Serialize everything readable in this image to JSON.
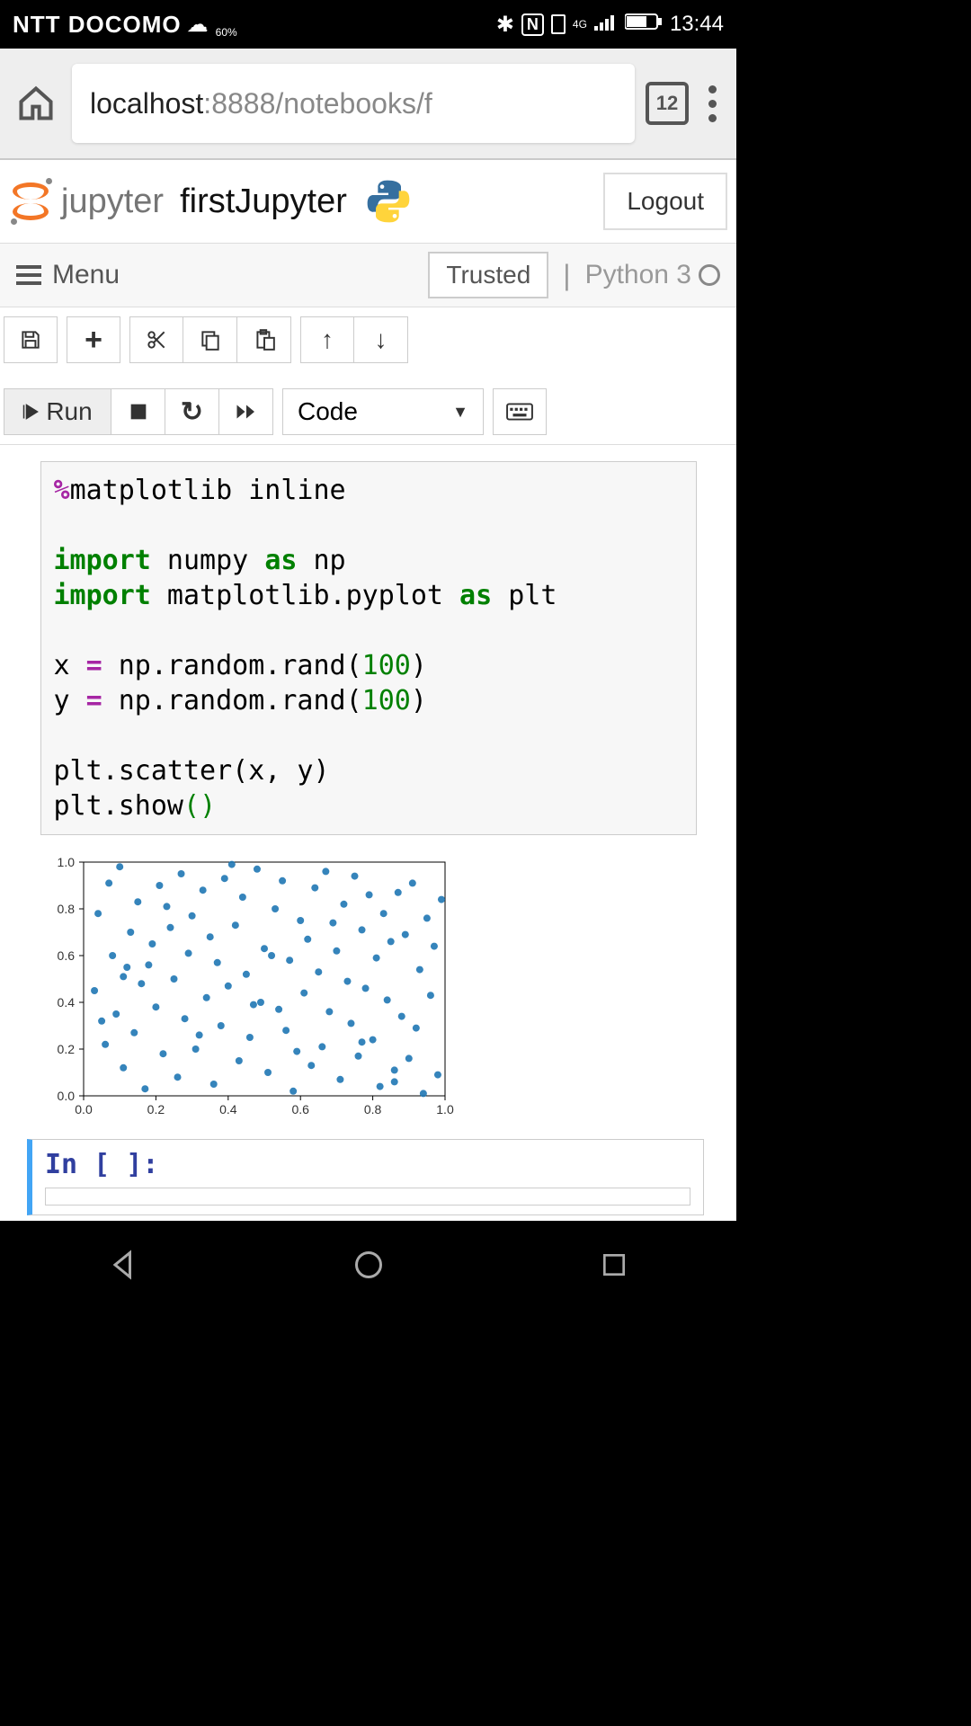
{
  "status": {
    "carrier": "NTT DOCOMO",
    "weather_sub": "60%",
    "time": "13:44"
  },
  "browser": {
    "url_host": "localhost",
    "url_rest": ":8888/notebooks/f",
    "tab_count": "12"
  },
  "header": {
    "logo_text": "jupyter",
    "notebook_title": "firstJupyter",
    "logout": "Logout"
  },
  "menubar": {
    "menu_label": "Menu",
    "trusted": "Trusted",
    "kernel": "Python 3"
  },
  "toolbar": {
    "run_label": "Run",
    "celltype": "Code"
  },
  "code": {
    "line1_mag": "%",
    "line1_rest": "matplotlib inline",
    "line3_kw": "import",
    "line3_mid": " numpy ",
    "line3_as": "as",
    "line3_end": " np",
    "line4_kw": "import",
    "line4_mid": " matplotlib.pyplot ",
    "line4_as": "as",
    "line4_end": " plt",
    "line6_pre": "x ",
    "line6_eq": "=",
    "line6_mid": " np.random.rand(",
    "line6_num": "100",
    "line6_end": ")",
    "line7_pre": "y ",
    "line7_eq": "=",
    "line7_mid": " np.random.rand(",
    "line7_num": "100",
    "line7_end": ")",
    "line9": "plt.scatter(x, y)",
    "line10_pre": "plt.show",
    "line10_p1": "(",
    "line10_p2": ")"
  },
  "next_prompt": "In [ ]:",
  "chart_data": {
    "type": "scatter",
    "xlabel": "",
    "ylabel": "",
    "xlim": [
      0,
      1
    ],
    "ylim": [
      0,
      1
    ],
    "xticks": [
      0.0,
      0.2,
      0.4,
      0.6,
      0.8,
      1.0
    ],
    "yticks": [
      0.0,
      0.2,
      0.4,
      0.6,
      0.8,
      1.0
    ],
    "series": [
      {
        "name": "points",
        "color": "#1f77b4",
        "x": [
          0.03,
          0.04,
          0.06,
          0.07,
          0.08,
          0.09,
          0.1,
          0.11,
          0.12,
          0.13,
          0.14,
          0.15,
          0.16,
          0.17,
          0.19,
          0.2,
          0.21,
          0.22,
          0.24,
          0.25,
          0.26,
          0.27,
          0.28,
          0.29,
          0.3,
          0.31,
          0.33,
          0.34,
          0.35,
          0.36,
          0.37,
          0.38,
          0.39,
          0.4,
          0.42,
          0.43,
          0.44,
          0.45,
          0.46,
          0.48,
          0.49,
          0.5,
          0.51,
          0.53,
          0.54,
          0.55,
          0.56,
          0.57,
          0.58,
          0.6,
          0.61,
          0.62,
          0.63,
          0.64,
          0.65,
          0.66,
          0.67,
          0.68,
          0.7,
          0.71,
          0.72,
          0.73,
          0.74,
          0.75,
          0.76,
          0.77,
          0.78,
          0.79,
          0.8,
          0.81,
          0.82,
          0.83,
          0.84,
          0.85,
          0.86,
          0.87,
          0.88,
          0.89,
          0.9,
          0.91,
          0.92,
          0.93,
          0.94,
          0.95,
          0.96,
          0.97,
          0.98,
          0.05,
          0.18,
          0.23,
          0.32,
          0.41,
          0.47,
          0.52,
          0.59,
          0.69,
          0.86,
          0.99,
          0.11,
          0.77
        ],
        "y": [
          0.45,
          0.78,
          0.22,
          0.91,
          0.6,
          0.35,
          0.98,
          0.12,
          0.55,
          0.7,
          0.27,
          0.83,
          0.48,
          0.03,
          0.65,
          0.38,
          0.9,
          0.18,
          0.72,
          0.5,
          0.08,
          0.95,
          0.33,
          0.61,
          0.77,
          0.2,
          0.88,
          0.42,
          0.68,
          0.05,
          0.57,
          0.3,
          0.93,
          0.47,
          0.73,
          0.15,
          0.85,
          0.52,
          0.25,
          0.97,
          0.4,
          0.63,
          0.1,
          0.8,
          0.37,
          0.92,
          0.28,
          0.58,
          0.02,
          0.75,
          0.44,
          0.67,
          0.13,
          0.89,
          0.53,
          0.21,
          0.96,
          0.36,
          0.62,
          0.07,
          0.82,
          0.49,
          0.31,
          0.94,
          0.17,
          0.71,
          0.46,
          0.86,
          0.24,
          0.59,
          0.04,
          0.78,
          0.41,
          0.66,
          0.11,
          0.87,
          0.34,
          0.69,
          0.16,
          0.91,
          0.29,
          0.54,
          0.01,
          0.76,
          0.43,
          0.64,
          0.09,
          0.32,
          0.56,
          0.81,
          0.26,
          0.99,
          0.39,
          0.6,
          0.19,
          0.74,
          0.06,
          0.84,
          0.51,
          0.23
        ]
      }
    ]
  }
}
